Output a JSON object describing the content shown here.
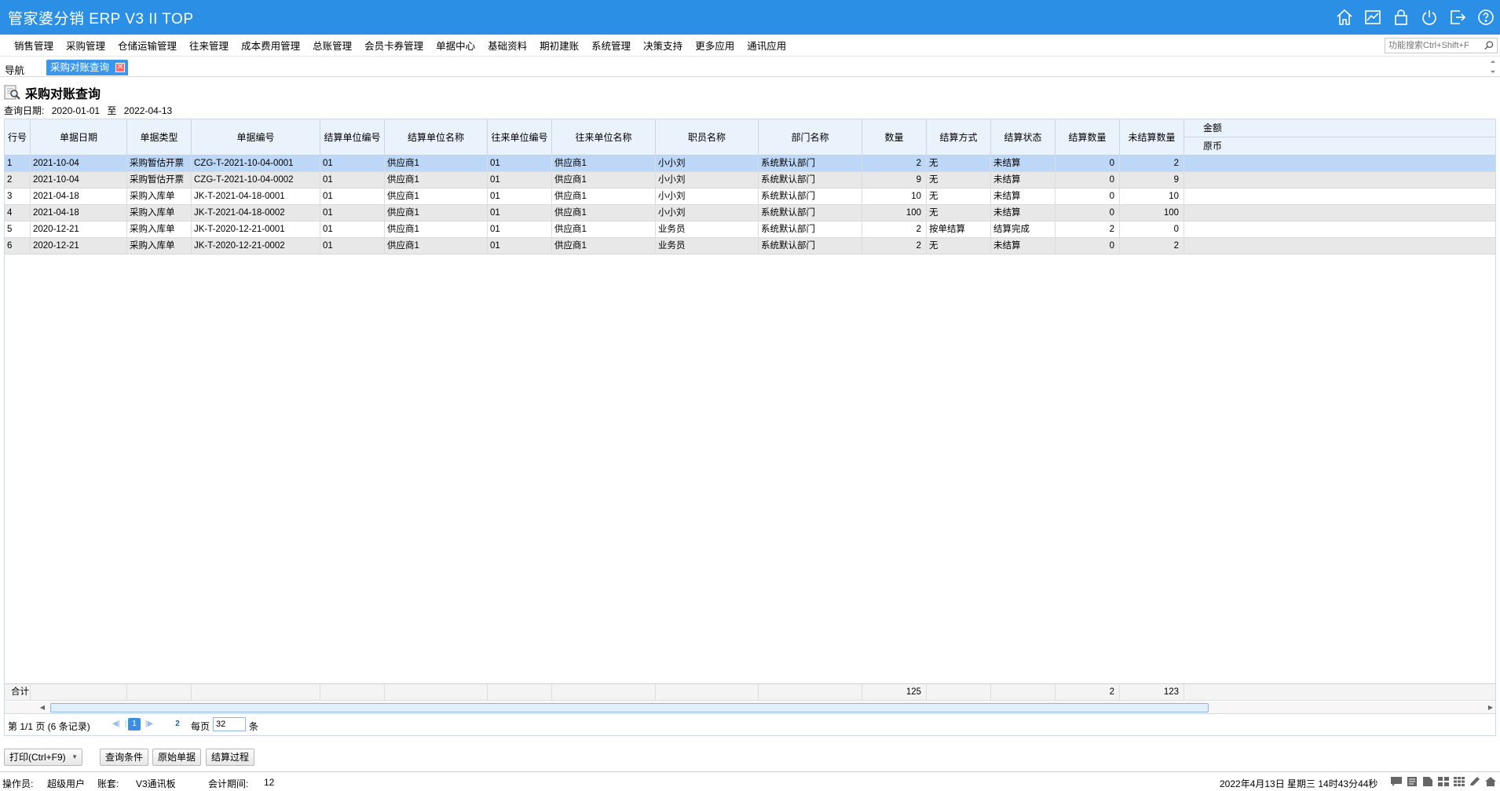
{
  "app": {
    "title": "管家婆分销 ERP V3 II TOP"
  },
  "title_icons": [
    "home-icon",
    "chart-icon",
    "lock-icon",
    "power-icon",
    "exit-icon",
    "help-icon"
  ],
  "menu": [
    "销售管理",
    "采购管理",
    "仓储运输管理",
    "往来管理",
    "成本费用管理",
    "总账管理",
    "会员卡券管理",
    "单据中心",
    "基础资料",
    "期初建账",
    "系统管理",
    "决策支持",
    "更多应用",
    "通讯应用"
  ],
  "search": {
    "placeholder": "功能搜索Ctrl+Shift+F"
  },
  "tabs": {
    "nav": "导航",
    "active": "采购对账查询",
    "close": "✕"
  },
  "page": {
    "title": "采购对账查询",
    "date_label": "查询日期:",
    "date_from": "2020-01-01",
    "date_to_label": "至",
    "date_to": "2022-04-13"
  },
  "grid": {
    "headers": [
      "行号",
      "单据日期",
      "单据类型",
      "单据编号",
      "结算单位编号",
      "结算单位名称",
      "往来单位编号",
      "往来单位名称",
      "职员名称",
      "部门名称",
      "数量",
      "结算方式",
      "结算状态",
      "结算数量",
      "未结算数量"
    ],
    "amount_header_top": "金额",
    "amount_header_sub": "原币",
    "rows": [
      [
        "1",
        "2021-10-04",
        "采购暂估开票",
        "CZG-T-2021-10-04-0001",
        "01",
        "供应商1",
        "01",
        "供应商1",
        "小小刘",
        "系统默认部门",
        "2",
        "无",
        "未结算",
        "0",
        "2"
      ],
      [
        "2",
        "2021-10-04",
        "采购暂估开票",
        "CZG-T-2021-10-04-0002",
        "01",
        "供应商1",
        "01",
        "供应商1",
        "小小刘",
        "系统默认部门",
        "9",
        "无",
        "未结算",
        "0",
        "9"
      ],
      [
        "3",
        "2021-04-18",
        "采购入库单",
        "JK-T-2021-04-18-0001",
        "01",
        "供应商1",
        "01",
        "供应商1",
        "小小刘",
        "系统默认部门",
        "10",
        "无",
        "未结算",
        "0",
        "10"
      ],
      [
        "4",
        "2021-04-18",
        "采购入库单",
        "JK-T-2021-04-18-0002",
        "01",
        "供应商1",
        "01",
        "供应商1",
        "小小刘",
        "系统默认部门",
        "100",
        "无",
        "未结算",
        "0",
        "100"
      ],
      [
        "5",
        "2020-12-21",
        "采购入库单",
        "JK-T-2020-12-21-0001",
        "01",
        "供应商1",
        "01",
        "供应商1",
        "业务员",
        "系统默认部门",
        "2",
        "按单结算",
        "结算完成",
        "2",
        "0"
      ],
      [
        "6",
        "2020-12-21",
        "采购入库单",
        "JK-T-2020-12-21-0002",
        "01",
        "供应商1",
        "01",
        "供应商1",
        "业务员",
        "系统默认部门",
        "2",
        "无",
        "未结算",
        "0",
        "2"
      ]
    ],
    "total": {
      "label": "合计",
      "quantity": "125",
      "settled_qty": "2",
      "unsettled_qty": "123"
    }
  },
  "pager": {
    "page_info": "第  1/1 页  (6 条记录)",
    "current": "1",
    "next_page": "2",
    "per_page_label": "每页",
    "per_page": "32",
    "unit": "条"
  },
  "buttons": {
    "print": "打印(Ctrl+F9)",
    "query": "查询条件",
    "original": "原始单据",
    "process": "结算过程"
  },
  "status": {
    "operator_label": "操作员:",
    "operator": "超级用户",
    "account_label": "账套:",
    "account": "V3通讯板",
    "period_label": "会计期间:",
    "period": "12",
    "datetime": "2022年4月13日  星期三  14时43分44秒"
  },
  "colors": {
    "titlebar": "#2b8fe6",
    "selected_row": "#bcd7f7",
    "header_bg": "#eaf2fb",
    "tab_active": "#3c97ea"
  }
}
